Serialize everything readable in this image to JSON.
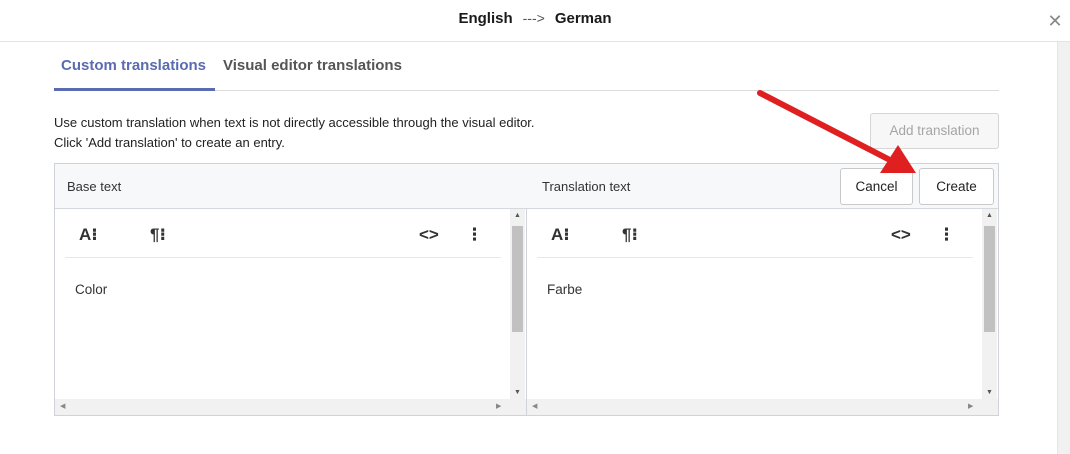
{
  "header": {
    "source_lang": "English",
    "separator": "--->",
    "target_lang": "German",
    "close_glyph": "✕"
  },
  "tabs": [
    {
      "label": "Custom translations",
      "active": true
    },
    {
      "label": "Visual editor translations",
      "active": false
    }
  ],
  "description": {
    "line1": "Use custom translation when text is not directly accessible through the visual editor.",
    "line2": "Click 'Add translation' to create an entry."
  },
  "add_translation_label": "Add translation",
  "panel": {
    "base_label": "Base text",
    "translation_label": "Translation text",
    "cancel_label": "Cancel",
    "create_label": "Create"
  },
  "editors": {
    "base": {
      "text": "Color"
    },
    "translation": {
      "text": "Farbe"
    }
  },
  "toolbar": {
    "font_glyph": "A⁝",
    "paragraph_glyph": "¶⁝",
    "code_glyph": "<>",
    "more_glyph": "⋮"
  },
  "colors": {
    "accent": "#5b6bb0",
    "annotation_arrow": "#e02020"
  },
  "icons": [
    "font-format-icon",
    "paragraph-format-icon",
    "code-view-icon",
    "more-options-icon",
    "close-icon"
  ]
}
